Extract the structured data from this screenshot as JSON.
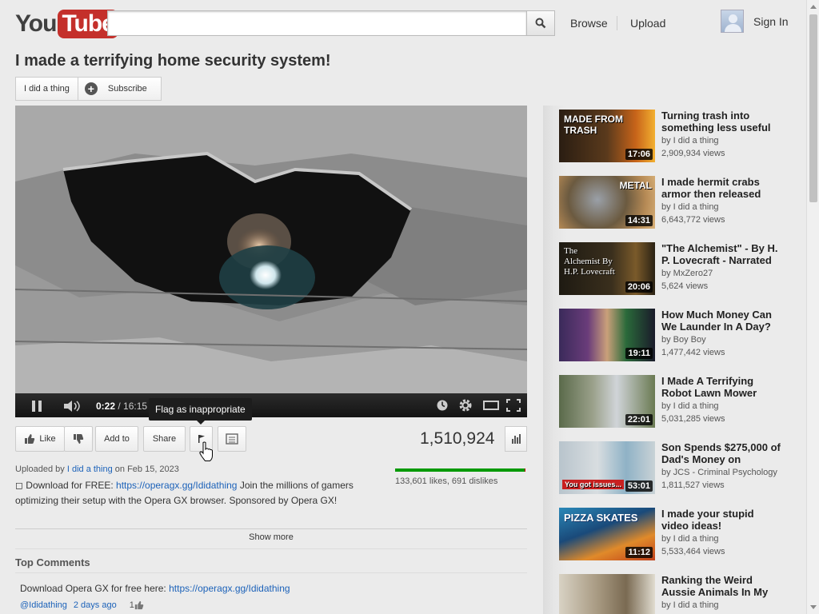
{
  "header": {
    "logo_you": "You",
    "logo_tube": "Tube",
    "search_placeholder": "",
    "browse": "Browse",
    "upload": "Upload",
    "sign_in": "Sign In"
  },
  "video": {
    "title": "I made a terrifying home security system!",
    "channel": "I did a thing",
    "subscribe": "Subscribe",
    "time_current": "0:22",
    "time_total": "/ 16:15",
    "progress_fraction": 0.0226,
    "views": "1,510,924",
    "likes_text": "133,601 likes, 691 dislikes",
    "like_fraction": 0.9949
  },
  "actions": {
    "like": "Like",
    "add_to": "Add to",
    "share": "Share",
    "flag_tooltip": "Flag as inappropriate"
  },
  "description": {
    "uploaded_by": "Uploaded by",
    "channel": "I did a thing",
    "date": "on Feb 15, 2023",
    "pre_link": "◻ Download for FREE:",
    "link": "https://operagx.gg/Ididathing",
    "post_link": "Join the millions of gamers optimizing their setup with the Opera GX browser. Sponsored by Opera GX!",
    "show_more": "Show more"
  },
  "comments": {
    "heading": "Top Comments",
    "items": [
      {
        "text": "Download Opera GX for free here:",
        "link": "https://operagx.gg/Ididathing",
        "author": "@Ididathing",
        "age": "2 days ago",
        "likes": "1"
      }
    ]
  },
  "related": [
    {
      "title": "Turning trash into something less useful",
      "by": "by I did a thing",
      "views": "2,909,934 views",
      "duration": "17:06",
      "caption": "MADE FROM TRASH"
    },
    {
      "title": "I made hermit crabs armor then released",
      "by": "by I did a thing",
      "views": "6,643,772 views",
      "duration": "14:31",
      "caption": "METAL"
    },
    {
      "title": "\"The Alchemist\" - By H. P. Lovecraft - Narrated",
      "by": "by MxZero27",
      "views": "5,624 views",
      "duration": "20:06",
      "caption": "The Alchemist By H.P. Lovecraft"
    },
    {
      "title": "How Much Money Can We Launder In A Day?",
      "by": "by Boy Boy",
      "views": "1,477,442 views",
      "duration": "19:11",
      "caption": ""
    },
    {
      "title": "I Made A Terrifying Robot Lawn Mower",
      "by": "by I did a thing",
      "views": "5,031,285 views",
      "duration": "22:01",
      "caption": ""
    },
    {
      "title": "Son Spends $275,000 of Dad's Money on",
      "by": "by JCS - Criminal Psychology",
      "views": "1,811,527 views",
      "duration": "53:01",
      "caption": "You got issues..."
    },
    {
      "title": "I made your stupid video ideas!",
      "by": "by I did a thing",
      "views": "5,533,464 views",
      "duration": "11:12",
      "caption": "PIZZA SKATES"
    },
    {
      "title": "Ranking the Weird Aussie Animals In My",
      "by": "by I did a thing",
      "views": "",
      "duration": "",
      "caption": ""
    }
  ],
  "colors": {
    "brand_red": "#c4302b",
    "link": "#1c62b9",
    "like_green": "#009900"
  }
}
